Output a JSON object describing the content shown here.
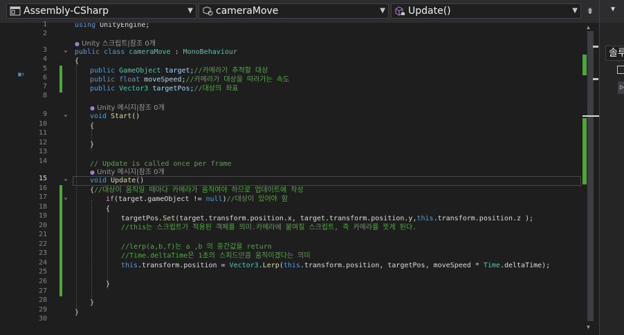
{
  "navbar": {
    "project": "Assembly-CSharp",
    "type_member": "cameraMove",
    "method": "Update()",
    "split_icon": "split-editor-icon"
  },
  "right_panel": {
    "label": "솔루"
  },
  "gutter": {
    "line_numbers": [
      "1",
      "2",
      "3",
      "4",
      "5",
      "6",
      "7",
      "8",
      "9",
      "10",
      "11",
      "12",
      "13",
      "14",
      "15",
      "16",
      "17",
      "18",
      "19",
      "20",
      "21",
      "22",
      "23",
      "24",
      "25",
      "26",
      "27",
      "28",
      "29",
      "30"
    ],
    "current_line": "15"
  },
  "code": {
    "l1_kw": "using",
    "l1_rest": " UnityEngine;",
    "lens1": "Unity 스크립트|참조 0개",
    "l3_kw1": "public",
    "l3_kw2": "class",
    "l3_name": "cameraMove",
    "l3_colon": " : ",
    "l3_base": "MonoBehaviour",
    "l4": "{",
    "l5_kw": "public",
    "l5_type": "GameObject",
    "l5_var": " target;",
    "l5_cm": "//카메라가 추적할 대상",
    "l6_kw": "public",
    "l6_type": "float",
    "l6_var": " moveSpeed;",
    "l6_cm": "//카메라가 대상을 따라가는 속도",
    "l7_kw": "public",
    "l7_type": "Vector3",
    "l7_var": " targetPos;",
    "l7_cm": "//대상의 좌표",
    "lens2": "Unity 메시지|참조 0개",
    "l9_kw": "void",
    "l9_fn": "Start",
    "l9_rest": "()",
    "l10": "{",
    "l12": "}",
    "l14_cm": "// Update is called once per frame",
    "lens3": "Unity 메시지|참조 0개",
    "l15_kw": "void",
    "l15_fn": "Update",
    "l15_rest": "()",
    "l16_brace": "{",
    "l16_cm": "//대상이 움직일 때마다 카메라가 움직여야 하므로 업데이트에 작성",
    "l17_kw": "if",
    "l17_a": "(target.gameObject != ",
    "l17_null": "null",
    "l17_b": ")",
    "l17_cm": "//대상이 있어야 함",
    "l18": "{",
    "l19_a": "targetPos.",
    "l19_fn": "Set",
    "l19_b": "(target.transform.position.x, target.transform.position.y,",
    "l19_this": "this",
    "l19_c": ".transform.position.z );",
    "l20_cm": "//this는 스크립트가 적용된 객체를 의미.카메라에 붙여질 스크립트, 즉 카메라를 뜻게 된다.",
    "l22_cm": "//lerp(a,b,f)는 a ,b 의 중간값을 return",
    "l23_cm": "//Time.deltaTime은 1초의 스피드만큼 움직이겠다는 의미",
    "l24_this1": "this",
    "l24_a": ".transform.position = ",
    "l24_type": "Vector3",
    "l24_dot": ".",
    "l24_fn": "Lerp",
    "l24_b": "(",
    "l24_this2": "this",
    "l24_c": ".transform.position, targetPos, moveSpeed * ",
    "l24_type2": "Time",
    "l24_d": ".deltaTime);",
    "l26": "}",
    "l28": "}",
    "l29": "}"
  },
  "colors": {
    "keyword": "#569cd6",
    "type": "#4ec9b0",
    "comment": "#57a64a",
    "method": "#dcdcaa",
    "changed_bar": "#4ea63a"
  }
}
